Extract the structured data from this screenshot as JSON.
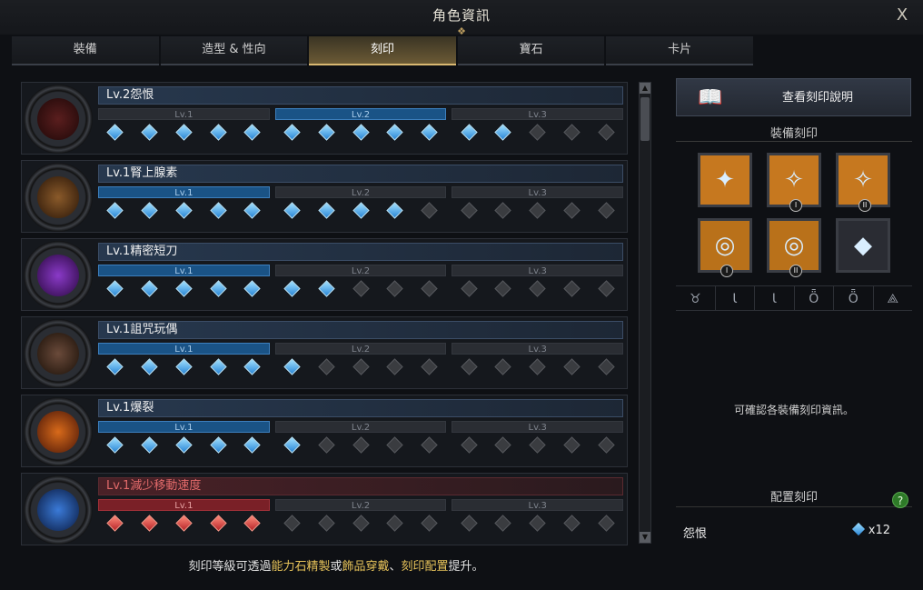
{
  "window": {
    "title": "角色資訊",
    "close_label": "X"
  },
  "tabs": [
    {
      "label": "裝備"
    },
    {
      "label": "造型 & 性向"
    },
    {
      "label": "刻印"
    },
    {
      "label": "寶石"
    },
    {
      "label": "卡片"
    }
  ],
  "active_tab": 2,
  "engravings": [
    {
      "name": "Lv.2怨恨",
      "level_labels": [
        "Lv.1",
        "Lv.2",
        "Lv.3"
      ],
      "active_level": 1,
      "points": [
        5,
        5,
        2
      ],
      "type": "buff"
    },
    {
      "name": "Lv.1腎上腺素",
      "level_labels": [
        "Lv.1",
        "Lv.2",
        "Lv.3"
      ],
      "active_level": 0,
      "points": [
        5,
        4,
        0
      ],
      "type": "buff"
    },
    {
      "name": "Lv.1精密短刀",
      "level_labels": [
        "Lv.1",
        "Lv.2",
        "Lv.3"
      ],
      "active_level": 0,
      "points": [
        5,
        2,
        0
      ],
      "type": "buff"
    },
    {
      "name": "Lv.1詛咒玩偶",
      "level_labels": [
        "Lv.1",
        "Lv.2",
        "Lv.3"
      ],
      "active_level": 0,
      "points": [
        5,
        1,
        0
      ],
      "type": "buff"
    },
    {
      "name": "Lv.1爆裂",
      "level_labels": [
        "Lv.1",
        "Lv.2",
        "Lv.3"
      ],
      "active_level": 0,
      "points": [
        5,
        1,
        0
      ],
      "type": "buff"
    },
    {
      "name": "Lv.1減少移動速度",
      "level_labels": [
        "Lv.1",
        "Lv.2",
        "Lv.3"
      ],
      "active_level": 0,
      "points": [
        5,
        0,
        0
      ],
      "type": "debuff"
    }
  ],
  "footer": {
    "prefix": "刻印等級可透過",
    "hl1": "能力石精製",
    "mid1": "或",
    "hl2": "飾品穿戴",
    "mid2": "、",
    "hl3": "刻印配置",
    "suffix": "提升。"
  },
  "right_panel": {
    "view_button_label": "查看刻印說明",
    "equipped_title": "裝備刻印",
    "slots": [
      {
        "icon": "necklace-icon",
        "glyph": "✦",
        "roman": ""
      },
      {
        "icon": "earring-icon",
        "glyph": "✧",
        "roman": "I"
      },
      {
        "icon": "earring-icon",
        "glyph": "✧",
        "roman": "II"
      },
      {
        "icon": "ring-icon",
        "glyph": "◎",
        "roman": "I"
      },
      {
        "icon": "ring-icon",
        "glyph": "◎",
        "roman": "II"
      },
      {
        "icon": "ability-stone-icon",
        "glyph": "◆",
        "roman": ""
      }
    ],
    "filters": [
      {
        "glyph": "♉",
        "icon": "necklace-filter-icon"
      },
      {
        "glyph": "Ɩ",
        "icon": "earring1-filter-icon"
      },
      {
        "glyph": "Ɩ",
        "icon": "earring2-filter-icon"
      },
      {
        "glyph": "Ȫ",
        "icon": "ring1-filter-icon"
      },
      {
        "glyph": "Ȫ",
        "icon": "ring2-filter-icon"
      },
      {
        "glyph": "⟁",
        "icon": "stone-filter-icon"
      }
    ],
    "info_text": "可確認各裝備刻印資訊。",
    "config_title": "配置刻印",
    "config_item_name": "怨恨",
    "config_item_value": "x12"
  },
  "colors": {
    "accent_gold": "#d9b872",
    "active_blue": "#1a5386",
    "debuff_red": "#7a2027"
  }
}
